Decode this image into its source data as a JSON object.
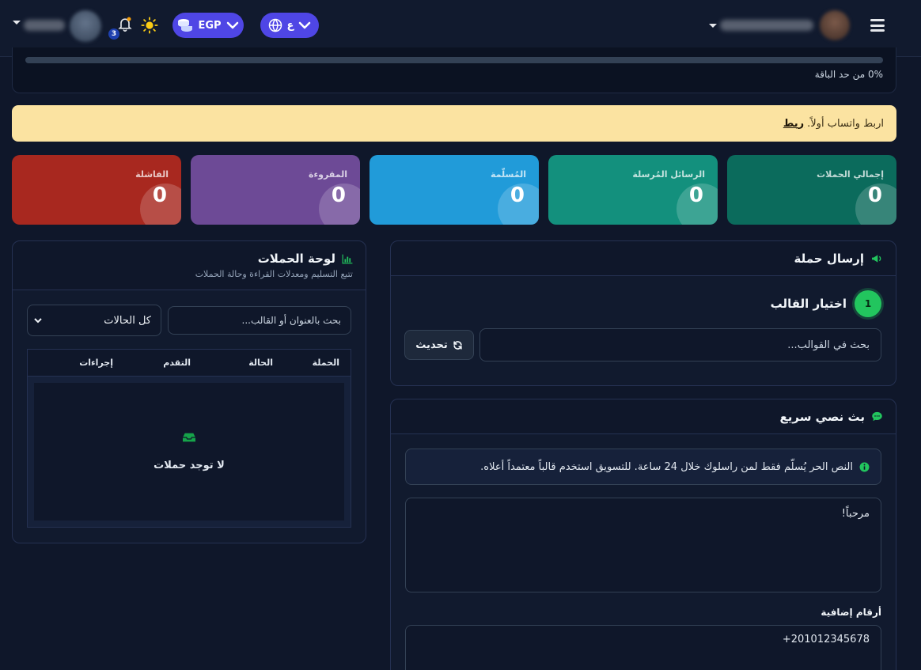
{
  "topbar": {
    "notification_count": "3",
    "currency_label": "EGP",
    "language_label": "ع"
  },
  "quota": {
    "used_percent": 0,
    "label": "0% من حد الباقة"
  },
  "alert": {
    "text": "اربط واتساب أولاً.",
    "link_label": "ربط"
  },
  "stats": [
    {
      "label": "إجمالي الحملات",
      "value": "0"
    },
    {
      "label": "الرسائل المُرسلة",
      "value": "0"
    },
    {
      "label": "المُسلّمة",
      "value": "0"
    },
    {
      "label": "المقروءة",
      "value": "0"
    },
    {
      "label": "الفاشلة",
      "value": "0"
    }
  ],
  "send_campaign": {
    "title": "إرسال حملة",
    "step_number": "1",
    "step_title": "اختيار القالب",
    "search_placeholder": "بحث في القوالب...",
    "refresh_label": "تحديث"
  },
  "quick_broadcast": {
    "title": "بث نصي سريع",
    "info_text": "النص الحر يُسلّم فقط لمن راسلوك خلال 24 ساعة. للتسويق استخدم قالباً معتمداً أعلاه.",
    "message_value": "مرحباً!",
    "extra_numbers_label": "أرقام إضافية",
    "extra_numbers_value": "+201012345678"
  },
  "dashboard": {
    "title": "لوحة الحملات",
    "subtitle": "تتبع التسليم ومعدلات القراءة وحالة الحملات",
    "search_placeholder": "بحث بالعنوان أو القالب...",
    "status_filter": "كل الحالات",
    "columns": [
      "الحملة",
      "الحالة",
      "التقدم",
      "إجراءات"
    ],
    "empty_text": "لا توجد حملات"
  },
  "colors": {
    "accent": "#4f46e5",
    "success": "#22c55e",
    "warning_bg": "#fbe3a1",
    "stat_total": "#0b6b5c",
    "stat_sent": "#13907d",
    "stat_delivered": "#219bd9",
    "stat_read": "#6d4a96",
    "stat_failed": "#a8281f"
  }
}
